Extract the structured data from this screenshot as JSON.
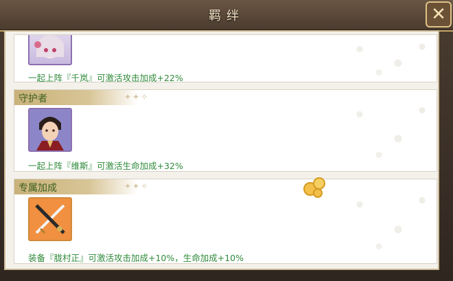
{
  "dialog": {
    "title": "羁绊",
    "close_icon": "close-icon"
  },
  "cards": [
    {
      "header": "",
      "portrait_icon": "character-portrait-icon",
      "description": "一起上阵『千岚』可激活攻击加成+22%"
    },
    {
      "header": "守护者",
      "portrait_icon": "character-portrait-icon",
      "description": "一起上阵『维斯』可激活生命加成+32%"
    },
    {
      "header": "专属加成",
      "portrait_icon": "sword-icon",
      "description": "装备『胧村正』可激活攻击加成+10%，生命加成+10%"
    }
  ],
  "colors": {
    "title_text": "#f5e6c8",
    "desc_text": "#2f8a3a",
    "header_text": "#3b5f1e",
    "header_band": "#c9b27a"
  }
}
